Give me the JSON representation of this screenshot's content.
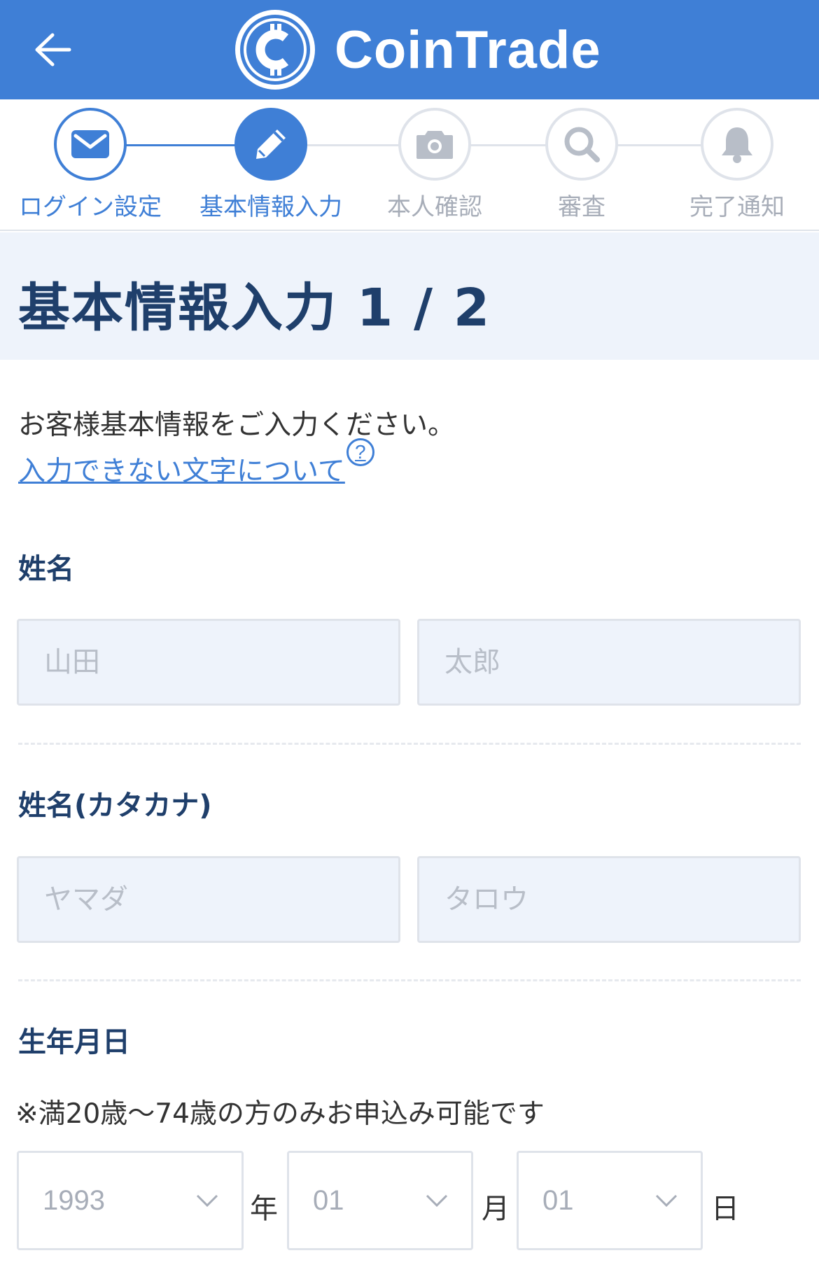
{
  "header": {
    "brand_name": "CoinTrade",
    "colors": {
      "primary": "#3f7fd6",
      "title": "#1f3f6b",
      "inactive": "#a7adb8"
    }
  },
  "steps": [
    {
      "label": "ログイン設定",
      "icon": "mail-icon",
      "state": "done"
    },
    {
      "label": "基本情報入力",
      "icon": "pencil-icon",
      "state": "current"
    },
    {
      "label": "本人確認",
      "icon": "camera-icon",
      "state": "todo"
    },
    {
      "label": "審査",
      "icon": "search-icon",
      "state": "todo"
    },
    {
      "label": "完了通知",
      "icon": "bell-icon",
      "state": "todo"
    }
  ],
  "page": {
    "title": "基本情報入力 1 / 2",
    "intro": "お客様基本情報をご入力ください。",
    "help_link": "入力できない文字について",
    "help_icon": "?"
  },
  "form": {
    "name": {
      "label": "姓名",
      "last_placeholder": "山田",
      "first_placeholder": "太郎"
    },
    "kana": {
      "label": "姓名(カタカナ)",
      "last_placeholder": "ヤマダ",
      "first_placeholder": "タロウ"
    },
    "birthday": {
      "label": "生年月日",
      "note": "※満20歳〜74歳の方のみお申込み可能です",
      "year": "1993",
      "year_unit": "年",
      "month": "01",
      "month_unit": "月",
      "day": "01",
      "day_unit": "日"
    }
  }
}
